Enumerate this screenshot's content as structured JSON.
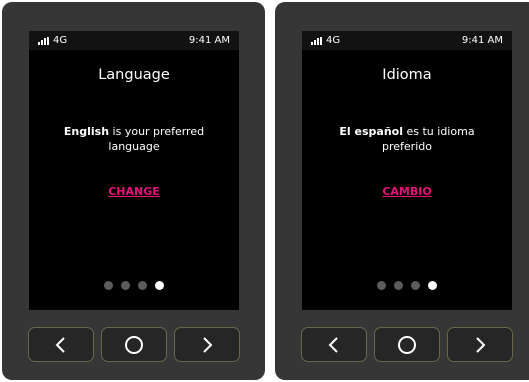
{
  "devices": [
    {
      "status": {
        "network": "4G",
        "time": "9:41 AM"
      },
      "title": "Language",
      "preferred_bold": "English",
      "preferred_rest": " is your preferred language",
      "change_label": "CHANGE",
      "dots": {
        "count": 4,
        "active_index": 3
      }
    },
    {
      "status": {
        "network": "4G",
        "time": "9:41 AM"
      },
      "title": "Idioma",
      "preferred_bold": "El español",
      "preferred_rest": " es tu idioma preferido",
      "change_label": "CAMBIO",
      "dots": {
        "count": 4,
        "active_index": 3
      }
    }
  ],
  "controls": {
    "prev_icon": "chevron-left-icon",
    "home_icon": "circle-icon",
    "next_icon": "chevron-right-icon"
  },
  "colors": {
    "accent": "#e8117a",
    "device_body": "#363636",
    "screen": "#000000",
    "dot_inactive": "#5c5c5c",
    "dot_active": "#ffffff"
  }
}
